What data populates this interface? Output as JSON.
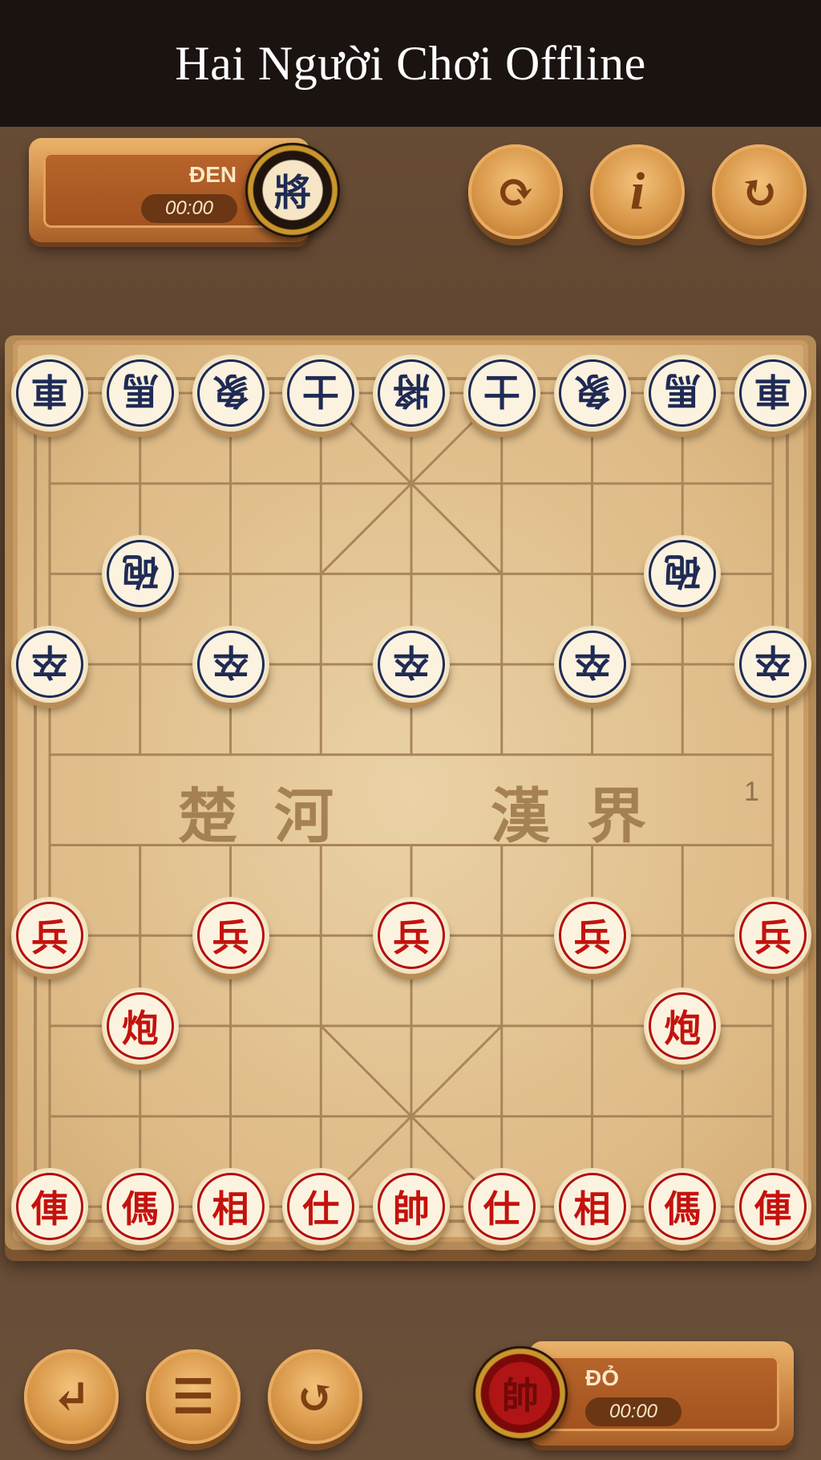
{
  "header": {
    "title": "Hai Người Chơi Offline"
  },
  "top_player": {
    "name": "ĐEN",
    "timer": "00:00",
    "avatar_char": "將"
  },
  "bottom_player": {
    "name": "ĐỎ",
    "timer": "00:00",
    "avatar_char": "帥"
  },
  "top_buttons": [
    {
      "name": "swap-sides-button",
      "icon": "refresh-arrows-icon",
      "glyph": "⟳"
    },
    {
      "name": "info-button",
      "icon": "info-icon",
      "glyph": "i"
    },
    {
      "name": "restart-button",
      "icon": "restart-icon",
      "glyph": "↻"
    }
  ],
  "bottom_buttons": [
    {
      "name": "back-button",
      "icon": "return-arrow-icon",
      "glyph": "↵"
    },
    {
      "name": "menu-button",
      "icon": "menu-icon",
      "glyph": "☰"
    },
    {
      "name": "undo-button",
      "icon": "undo-icon",
      "glyph": "↺"
    }
  ],
  "board": {
    "river_left": [
      "楚",
      "河"
    ],
    "river_right": [
      "漢",
      "界"
    ],
    "move_count": "1"
  },
  "pieces": [
    {
      "side": "black",
      "char": "車",
      "file": 0,
      "rank": 0
    },
    {
      "side": "black",
      "char": "馬",
      "file": 1,
      "rank": 0
    },
    {
      "side": "black",
      "char": "象",
      "file": 2,
      "rank": 0
    },
    {
      "side": "black",
      "char": "士",
      "file": 3,
      "rank": 0
    },
    {
      "side": "black",
      "char": "將",
      "file": 4,
      "rank": 0
    },
    {
      "side": "black",
      "char": "士",
      "file": 5,
      "rank": 0
    },
    {
      "side": "black",
      "char": "象",
      "file": 6,
      "rank": 0
    },
    {
      "side": "black",
      "char": "馬",
      "file": 7,
      "rank": 0
    },
    {
      "side": "black",
      "char": "車",
      "file": 8,
      "rank": 0
    },
    {
      "side": "black",
      "char": "砲",
      "file": 1,
      "rank": 2
    },
    {
      "side": "black",
      "char": "砲",
      "file": 7,
      "rank": 2
    },
    {
      "side": "black",
      "char": "卒",
      "file": 0,
      "rank": 3
    },
    {
      "side": "black",
      "char": "卒",
      "file": 2,
      "rank": 3
    },
    {
      "side": "black",
      "char": "卒",
      "file": 4,
      "rank": 3
    },
    {
      "side": "black",
      "char": "卒",
      "file": 6,
      "rank": 3
    },
    {
      "side": "black",
      "char": "卒",
      "file": 8,
      "rank": 3
    },
    {
      "side": "red",
      "char": "兵",
      "file": 0,
      "rank": 6
    },
    {
      "side": "red",
      "char": "兵",
      "file": 2,
      "rank": 6
    },
    {
      "side": "red",
      "char": "兵",
      "file": 4,
      "rank": 6
    },
    {
      "side": "red",
      "char": "兵",
      "file": 6,
      "rank": 6
    },
    {
      "side": "red",
      "char": "兵",
      "file": 8,
      "rank": 6
    },
    {
      "side": "red",
      "char": "炮",
      "file": 1,
      "rank": 7
    },
    {
      "side": "red",
      "char": "炮",
      "file": 7,
      "rank": 7
    },
    {
      "side": "red",
      "char": "俥",
      "file": 0,
      "rank": 9
    },
    {
      "side": "red",
      "char": "傌",
      "file": 1,
      "rank": 9
    },
    {
      "side": "red",
      "char": "相",
      "file": 2,
      "rank": 9
    },
    {
      "side": "red",
      "char": "仕",
      "file": 3,
      "rank": 9
    },
    {
      "side": "red",
      "char": "帥",
      "file": 4,
      "rank": 9
    },
    {
      "side": "red",
      "char": "仕",
      "file": 5,
      "rank": 9
    },
    {
      "side": "red",
      "char": "相",
      "file": 6,
      "rank": 9
    },
    {
      "side": "red",
      "char": "傌",
      "file": 7,
      "rank": 9
    },
    {
      "side": "red",
      "char": "俥",
      "file": 8,
      "rank": 9
    }
  ]
}
